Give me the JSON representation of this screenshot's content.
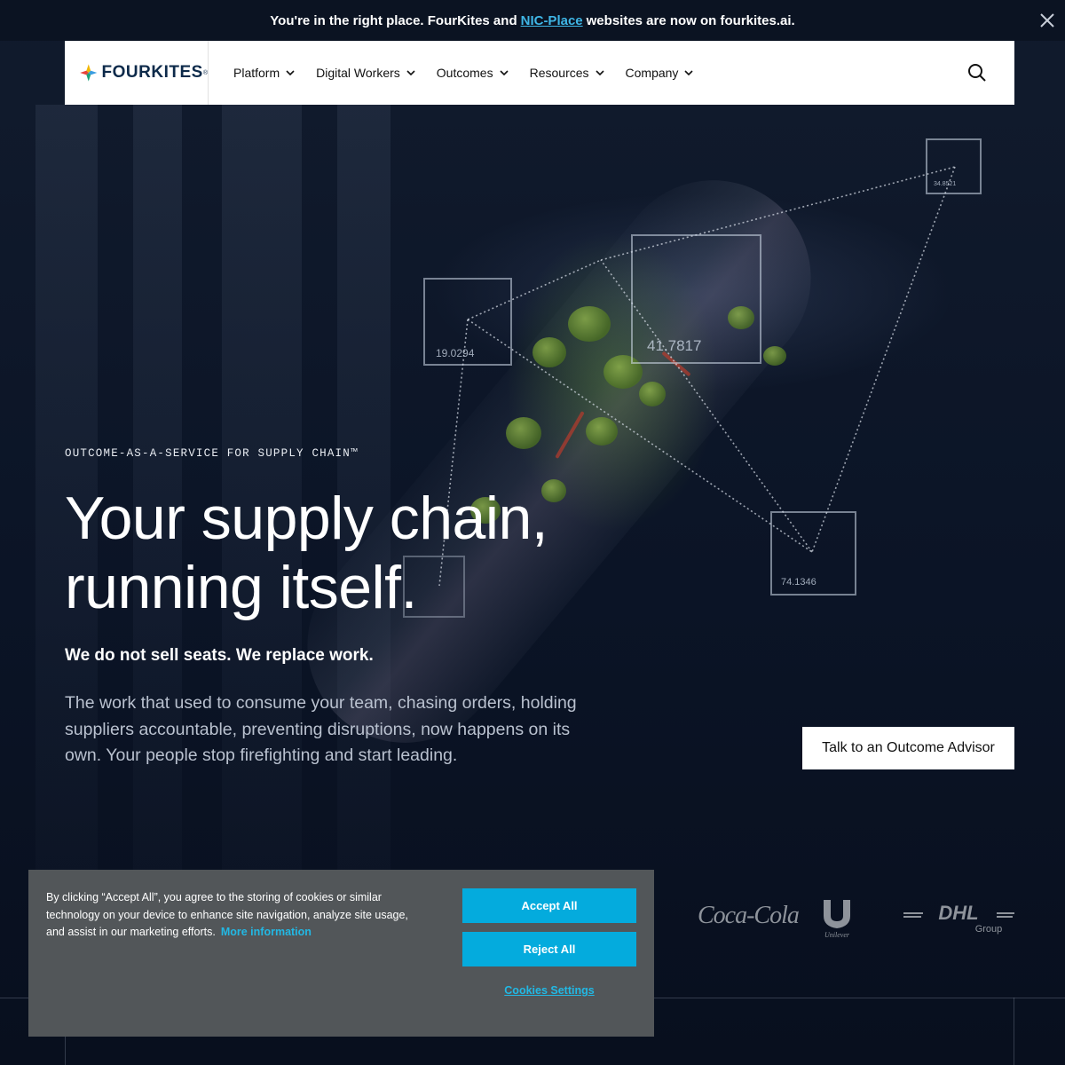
{
  "announcement": {
    "text_before": "You're in the right place. FourKites and",
    "link_text": "NIC-Place",
    "text_after": "websites are now on fourkites.ai."
  },
  "nav": {
    "logo_text": "FOURKITES",
    "logo_tm": "®",
    "menu": [
      {
        "label": "Platform"
      },
      {
        "label": "Digital Workers"
      },
      {
        "label": "Outcomes"
      },
      {
        "label": "Resources"
      },
      {
        "label": "Company"
      }
    ]
  },
  "hero": {
    "eyebrow": "OUTCOME-AS-A-SERVICE FOR SUPPLY CHAIN™",
    "headline_line1": "Your supply chain,",
    "headline_line2": "running itself.",
    "tagline": "We do not sell seats. We replace work.",
    "body": "The work that used to consume your team, chasing orders, holding suppliers accountable, preventing disruptions, now happens on its own. Your people stop firefighting and start leading.",
    "cta_label": "Talk to an Outcome Advisor",
    "data_values": [
      "19.0294",
      "41.7817",
      "34.8521",
      "74.1346"
    ]
  },
  "customer_logos": {
    "coke": "Coca-Cola",
    "unilever": "Unilever",
    "dhl": "DHL",
    "dhl_sub": "Group"
  },
  "cookie_banner": {
    "text": "By clicking “Accept All”, you agree to the storing of cookies or similar technology on your device to enhance site navigation, analyze site usage, and assist in our marketing efforts.",
    "more_info": "More information",
    "accept_label": "Accept All",
    "reject_label": "Reject All",
    "settings_label": "Cookies Settings"
  },
  "colors": {
    "background": "#0a1220",
    "link_accent": "#3fb6e6",
    "cookie_button": "#04abdd",
    "cookie_bg": "#525659"
  }
}
